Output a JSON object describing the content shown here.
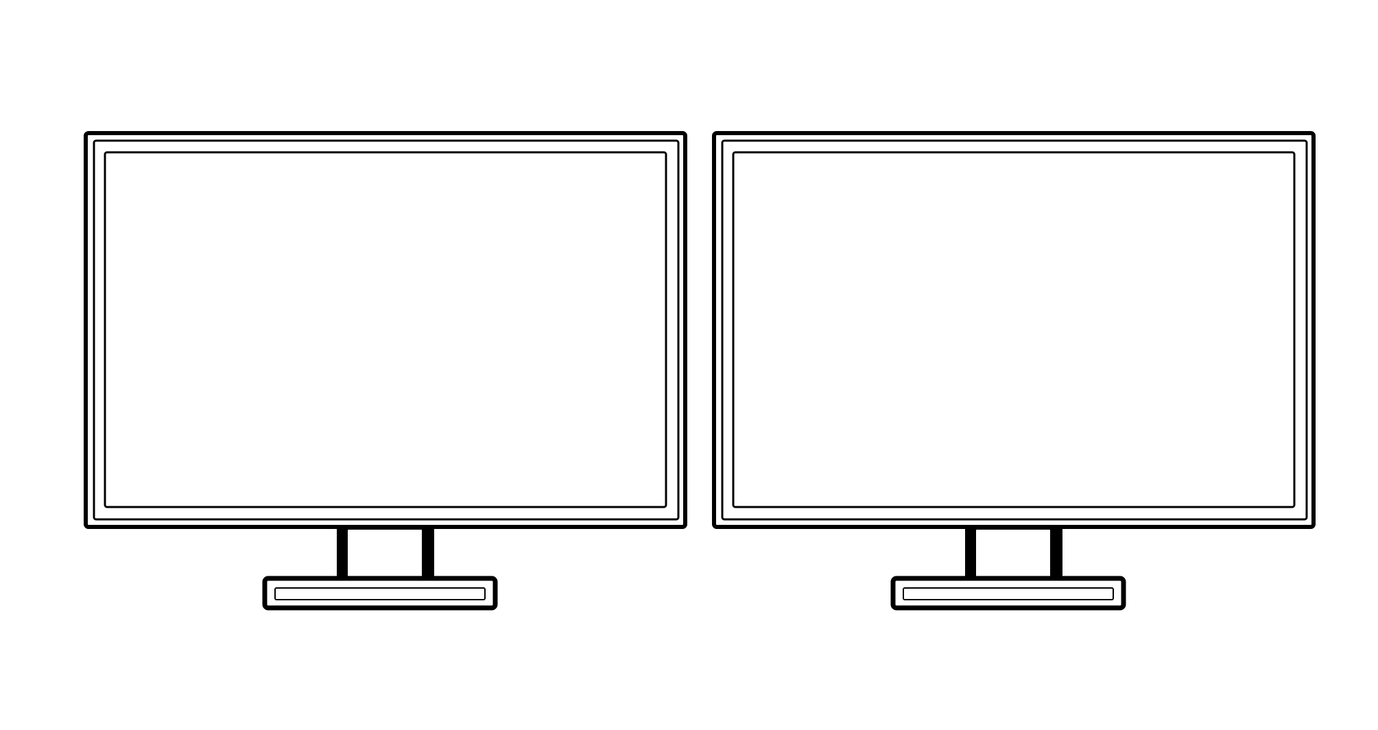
{
  "scene": {
    "monitors": [
      {
        "icon": "monitor-icon",
        "screen": "blank"
      },
      {
        "icon": "monitor-icon",
        "screen": "blank"
      }
    ],
    "colors": {
      "background": "#ffffff",
      "stroke": "#000000"
    }
  }
}
